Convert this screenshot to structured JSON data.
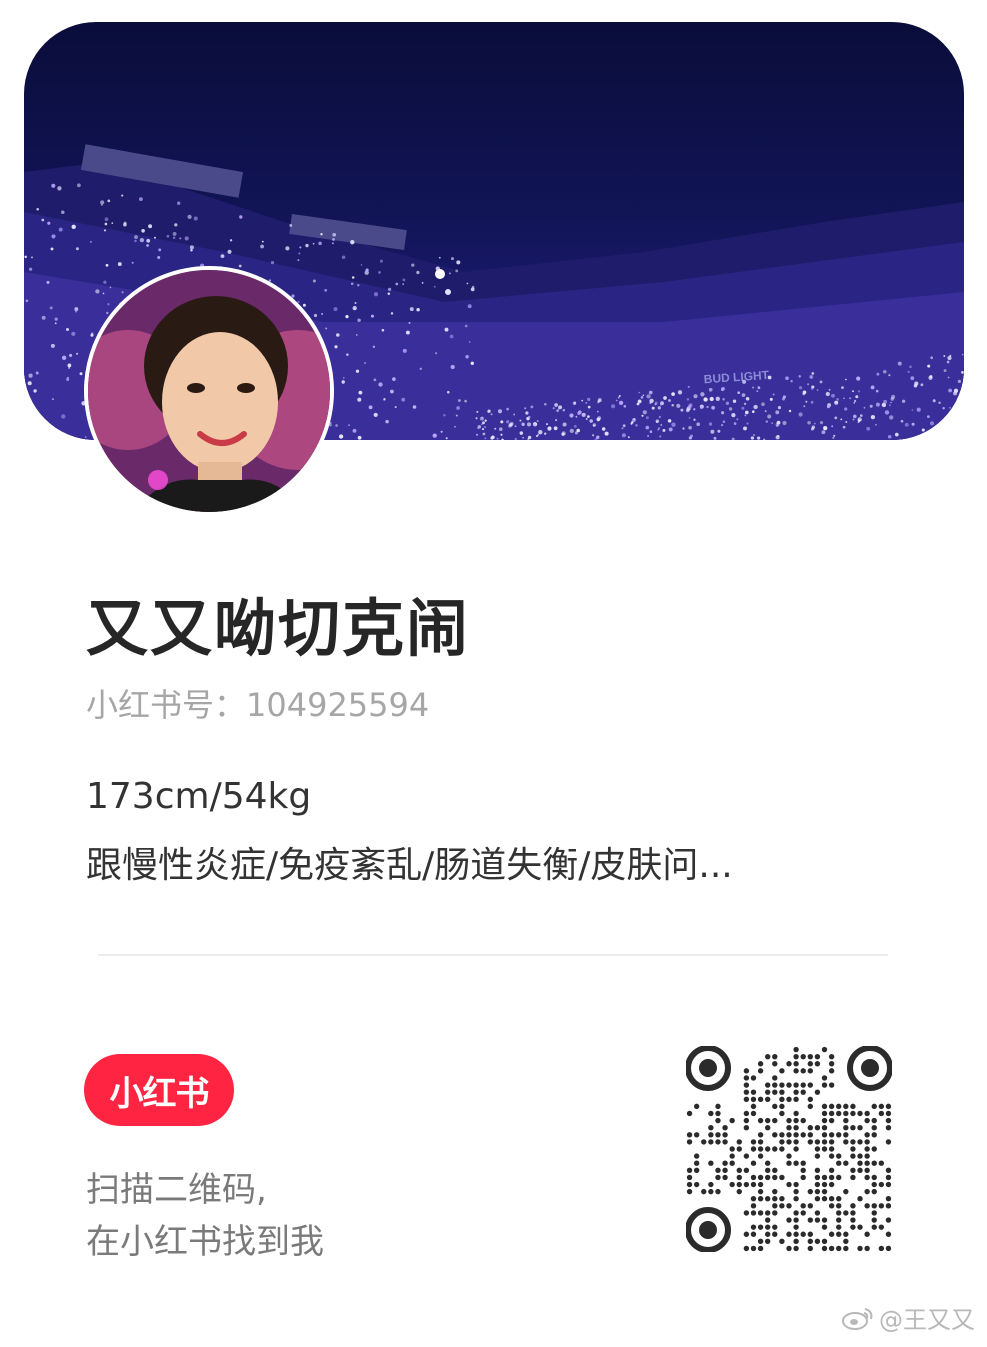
{
  "profile": {
    "nickname": "又又呦切克闹",
    "id_line": "小红书号：104925594",
    "bio_line_1": "173cm/54kg",
    "bio_line_2": "跟慢性炎症/免疫紊乱/肠道失衡/皮肤问..."
  },
  "cover": {
    "description_icon": "stadium-cover-image",
    "banner_text": "BUD LIGHT"
  },
  "avatar": {
    "icon": "avatar-image"
  },
  "footer": {
    "brand_label": "小红书",
    "brand_color": "#ff2442",
    "scan_line_1": "扫描二维码,",
    "scan_line_2": "在小红书找到我",
    "qr_icon": "qr-code"
  },
  "watermark": {
    "text": "@王又又",
    "icon": "weibo-icon"
  }
}
